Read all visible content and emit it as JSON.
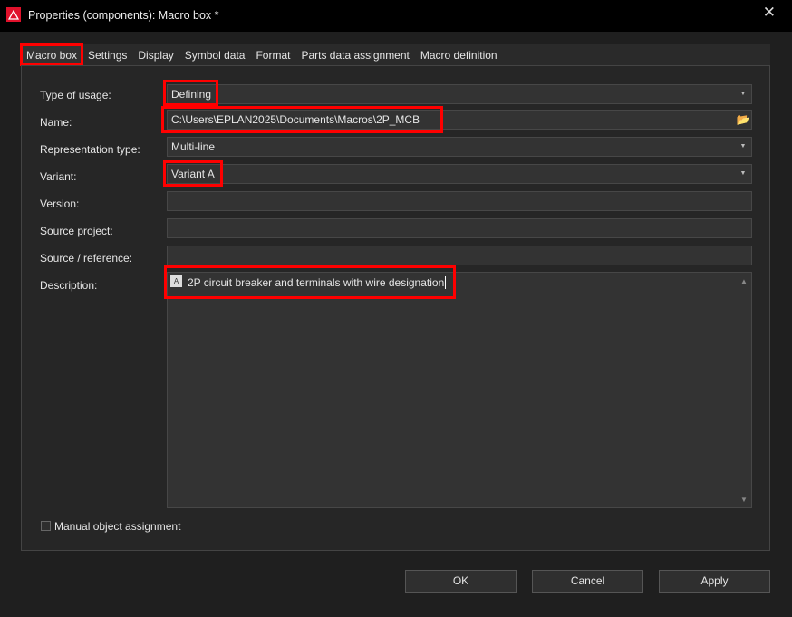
{
  "window": {
    "title": "Properties (components): Macro box *"
  },
  "tabs": [
    "Macro box",
    "Settings",
    "Display",
    "Symbol data",
    "Format",
    "Parts data assignment",
    "Macro definition"
  ],
  "form": {
    "type_of_usage": {
      "label": "Type of usage:",
      "value": "Defining"
    },
    "name": {
      "label": "Name:",
      "value": "C:\\Users\\EPLAN2025\\Documents\\Macros\\2P_MCB"
    },
    "representation_type": {
      "label": "Representation type:",
      "value": "Multi-line"
    },
    "variant": {
      "label": "Variant:",
      "value": "Variant A"
    },
    "version": {
      "label": "Version:",
      "value": ""
    },
    "source_project": {
      "label": "Source project:",
      "value": ""
    },
    "source_reference": {
      "label": "Source / reference:",
      "value": ""
    },
    "description": {
      "label": "Description:",
      "value": "2P circuit breaker and terminals with wire designation"
    },
    "manual_object_assignment": {
      "label": "Manual object assignment",
      "checked": false
    }
  },
  "buttons": {
    "ok": "OK",
    "cancel": "Cancel",
    "apply": "Apply"
  }
}
